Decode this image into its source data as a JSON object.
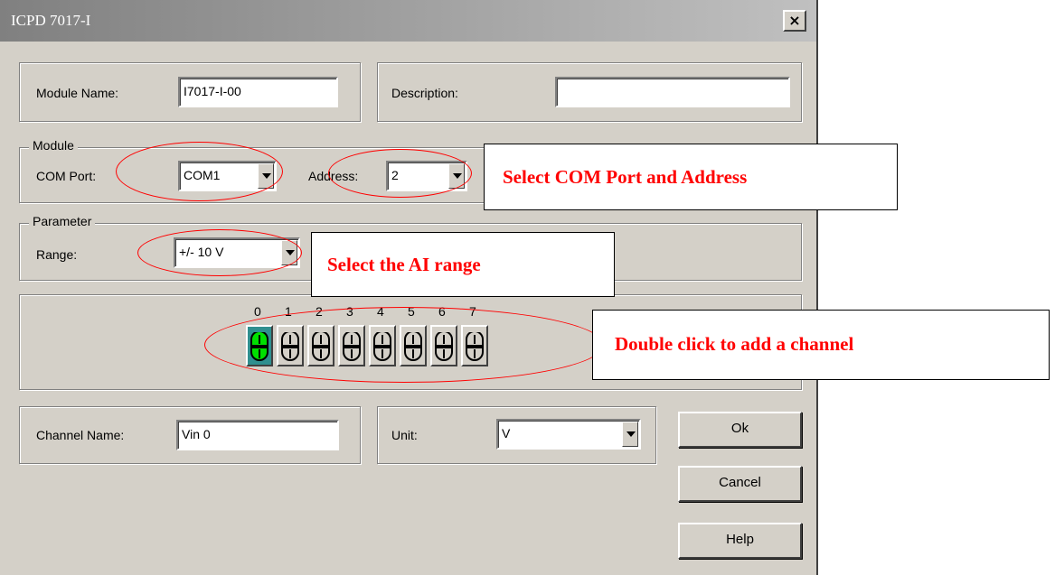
{
  "window": {
    "title": "ICPD 7017-I",
    "close_label": "×"
  },
  "module_name": {
    "label": "Module Name:",
    "value": "I7017-I-00"
  },
  "description": {
    "label": "Description:",
    "value": ""
  },
  "module_group": {
    "legend": "Module",
    "com_port_label": "COM Port:",
    "com_port_value": "COM1",
    "address_label": "Address:",
    "address_value": "2"
  },
  "parameter_group": {
    "legend": "Parameter",
    "range_label": "Range:",
    "range_value": "+/- 10 V"
  },
  "channels": {
    "numbers": [
      "0",
      "1",
      "2",
      "3",
      "4",
      "5",
      "6",
      "7"
    ],
    "selected_index": 0
  },
  "channel_name": {
    "label": "Channel Name:",
    "value": "Vin 0"
  },
  "unit": {
    "label": "Unit:",
    "value": "V"
  },
  "buttons": {
    "ok": "Ok",
    "cancel": "Cancel",
    "help": "Help"
  },
  "annotations": {
    "com_address": "Select COM Port and Address",
    "ai_range": "Select the AI range",
    "add_channel": "Double click to add a channel"
  },
  "colors": {
    "annotation": "#ff0000",
    "dialog_bg": "#d4d0c8",
    "selected_channel": "#2f8f8f"
  }
}
